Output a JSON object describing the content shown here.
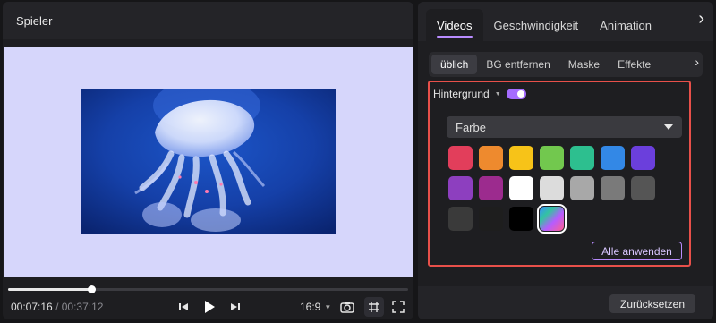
{
  "player": {
    "title": "Spieler",
    "canvas_color": "#d6d6fb",
    "video_subject_icon": "jellyfish-image",
    "progress_fraction": 0.207,
    "time_current": "00:07:16",
    "time_separator": "/",
    "time_total": "00:37:12",
    "aspect_ratio": "16:9",
    "controls": [
      "skip-back-icon",
      "play-icon",
      "skip-forward-icon",
      "chevron-down-icon",
      "camera-icon",
      "grid-icon",
      "fullscreen-icon"
    ]
  },
  "props": {
    "tabs": [
      {
        "label": "Videos",
        "active": true
      },
      {
        "label": "Geschwindigkeit",
        "active": false
      },
      {
        "label": "Animation",
        "active": false
      }
    ],
    "tabs_more": "›",
    "subtabs": [
      {
        "label": "üblich",
        "active": true
      },
      {
        "label": "BG entfernen",
        "active": false
      },
      {
        "label": "Maske",
        "active": false
      },
      {
        "label": "Effekte",
        "active": false
      }
    ],
    "subtabs_more": "›",
    "background": {
      "label": "Hintergrund",
      "enabled": true,
      "mode": "Farbe",
      "colors": [
        "#e23e5b",
        "#ee8a2e",
        "#f7c318",
        "#72c84e",
        "#2dbf8f",
        "#3388e6",
        "#6b3fdc",
        "#8d3fbf",
        "#9c2b8e",
        "#ffffff",
        "#dcdcdc",
        "#a8a8a8",
        "#7a7a7a",
        "#555555",
        "#3a3a3a",
        "#1e1e1e",
        "#000000",
        "gradient"
      ],
      "selected_index": 17,
      "apply_all": "Alle anwenden"
    },
    "reset": "Zurücksetzen",
    "accent": "#b98cff",
    "highlight": "#e8504a"
  }
}
